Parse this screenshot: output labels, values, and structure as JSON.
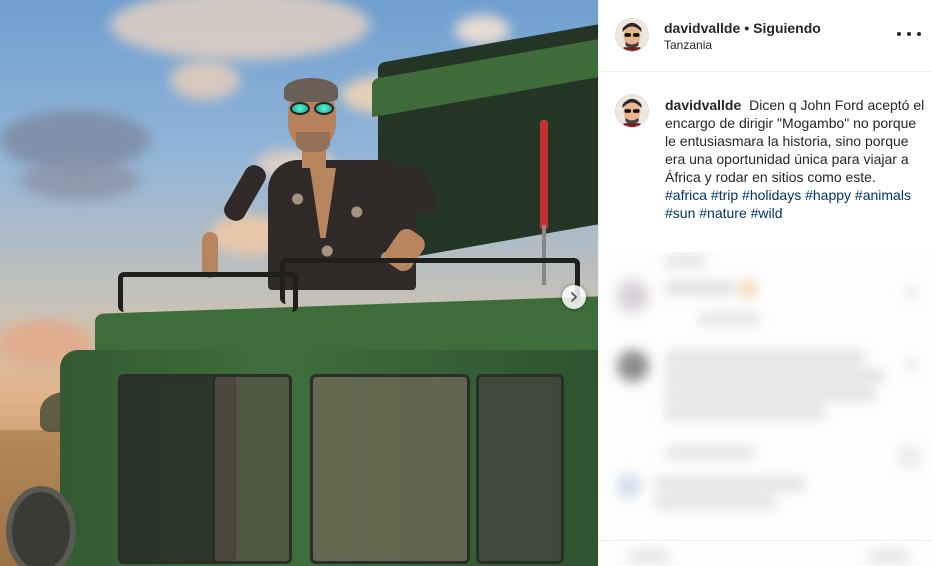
{
  "post": {
    "username": "davidvallde",
    "separator": "•",
    "follow_status": "Siguiendo",
    "location": "Tanzania",
    "caption_text": "Dicen q John Ford aceptó el encargo de dirigir \"Mogambo\" no porque le entusiasmara la historia, sino porque era una oportunidad única para viajar a África y rodar en sitios como este.",
    "hashtags": [
      "#africa",
      "#trip",
      "#holidays",
      "#happy",
      "#animals",
      "#sun",
      "#nature",
      "#wild"
    ]
  },
  "icons": {
    "more_options": "more-options-icon",
    "next_photo": "chevron-right-icon"
  },
  "colors": {
    "hashtag": "#003569",
    "jeep_green": "#3e6d3b",
    "text": "#262626"
  }
}
